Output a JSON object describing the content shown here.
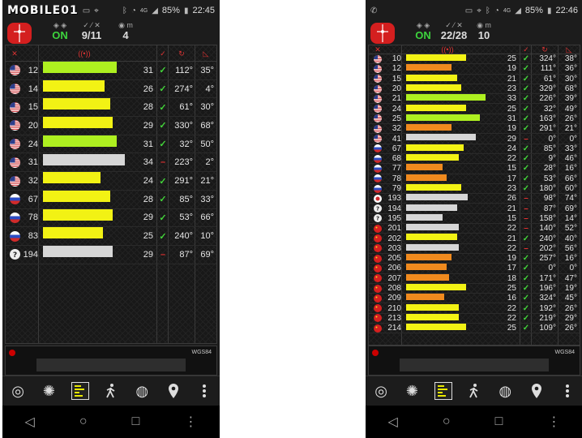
{
  "left": {
    "status": {
      "brand": "MOBILE01",
      "battery": "85%",
      "time": "22:45",
      "signal": "4G"
    },
    "header": {
      "fix_status": "ON",
      "in_use": "9/11",
      "extra": "4"
    },
    "footer": {
      "datum": "WGS84"
    },
    "sats": [
      {
        "flag": "us",
        "prn": "12",
        "snr": "31",
        "level": 0.86,
        "color": "#aef020",
        "used": "check",
        "az": "112°",
        "el": "35°"
      },
      {
        "flag": "us",
        "prn": "14",
        "snr": "26",
        "level": 0.72,
        "color": "#f2f214",
        "used": "check",
        "az": "274°",
        "el": "4°"
      },
      {
        "flag": "us",
        "prn": "15",
        "snr": "28",
        "level": 0.78,
        "color": "#f2f214",
        "used": "check",
        "az": "61°",
        "el": "30°"
      },
      {
        "flag": "us",
        "prn": "20",
        "snr": "29",
        "level": 0.81,
        "color": "#f2f214",
        "used": "check",
        "az": "330°",
        "el": "68°"
      },
      {
        "flag": "us",
        "prn": "24",
        "snr": "31",
        "level": 0.86,
        "color": "#aef020",
        "used": "check",
        "az": "32°",
        "el": "50°"
      },
      {
        "flag": "us",
        "prn": "31",
        "snr": "34",
        "level": 0.95,
        "color": "#d6d6d6",
        "used": "dash",
        "az": "223°",
        "el": "2°"
      },
      {
        "flag": "us",
        "prn": "32",
        "snr": "24",
        "level": 0.67,
        "color": "#f2f214",
        "used": "check",
        "az": "291°",
        "el": "21°"
      },
      {
        "flag": "ru",
        "prn": "67",
        "snr": "28",
        "level": 0.78,
        "color": "#f2f214",
        "used": "check",
        "az": "85°",
        "el": "33°"
      },
      {
        "flag": "ru",
        "prn": "78",
        "snr": "29",
        "level": 0.81,
        "color": "#f2f214",
        "used": "check",
        "az": "53°",
        "el": "66°"
      },
      {
        "flag": "ru",
        "prn": "83",
        "snr": "25",
        "level": 0.7,
        "color": "#f2f214",
        "used": "check",
        "az": "240°",
        "el": "10°"
      },
      {
        "flag": "q",
        "prn": "194",
        "snr": "29",
        "level": 0.81,
        "color": "#d6d6d6",
        "used": "dash",
        "az": "87°",
        "el": "69°"
      }
    ]
  },
  "right": {
    "status": {
      "battery": "85%",
      "time": "22:46",
      "signal": "4G"
    },
    "header": {
      "fix_status": "ON",
      "in_use": "22/28",
      "extra": "10"
    },
    "footer": {
      "datum": "WGS84"
    },
    "sats": [
      {
        "flag": "us",
        "prn": "10",
        "snr": "25",
        "level": 0.7,
        "color": "#f2f214",
        "used": "check",
        "az": "324°",
        "el": "38°"
      },
      {
        "flag": "us",
        "prn": "12",
        "snr": "19",
        "level": 0.53,
        "color": "#f08a1e",
        "used": "check",
        "az": "111°",
        "el": "36°"
      },
      {
        "flag": "us",
        "prn": "15",
        "snr": "21",
        "level": 0.59,
        "color": "#f2f214",
        "used": "check",
        "az": "61°",
        "el": "30°"
      },
      {
        "flag": "us",
        "prn": "20",
        "snr": "23",
        "level": 0.64,
        "color": "#f2f214",
        "used": "check",
        "az": "329°",
        "el": "68°"
      },
      {
        "flag": "us",
        "prn": "21",
        "snr": "33",
        "level": 0.92,
        "color": "#aef020",
        "used": "check",
        "az": "226°",
        "el": "39°"
      },
      {
        "flag": "us",
        "prn": "24",
        "snr": "25",
        "level": 0.7,
        "color": "#f2f214",
        "used": "check",
        "az": "32°",
        "el": "49°"
      },
      {
        "flag": "us",
        "prn": "25",
        "snr": "31",
        "level": 0.86,
        "color": "#aef020",
        "used": "check",
        "az": "163°",
        "el": "26°"
      },
      {
        "flag": "us",
        "prn": "32",
        "snr": "19",
        "level": 0.53,
        "color": "#f08a1e",
        "used": "check",
        "az": "291°",
        "el": "21°"
      },
      {
        "flag": "us",
        "prn": "41",
        "snr": "29",
        "level": 0.81,
        "color": "#d6d6d6",
        "used": "dash",
        "az": "0°",
        "el": "0°"
      },
      {
        "flag": "ru",
        "prn": "67",
        "snr": "24",
        "level": 0.67,
        "color": "#f2f214",
        "used": "check",
        "az": "85°",
        "el": "33°"
      },
      {
        "flag": "ru",
        "prn": "68",
        "snr": "22",
        "level": 0.61,
        "color": "#f2f214",
        "used": "check",
        "az": "9°",
        "el": "46°"
      },
      {
        "flag": "ru",
        "prn": "77",
        "snr": "15",
        "level": 0.42,
        "color": "#f08a1e",
        "used": "check",
        "az": "28°",
        "el": "16°"
      },
      {
        "flag": "ru",
        "prn": "78",
        "snr": "17",
        "level": 0.47,
        "color": "#f08a1e",
        "used": "check",
        "az": "53°",
        "el": "66°"
      },
      {
        "flag": "ru",
        "prn": "79",
        "snr": "23",
        "level": 0.64,
        "color": "#f2f214",
        "used": "check",
        "az": "180°",
        "el": "60°"
      },
      {
        "flag": "jp",
        "prn": "193",
        "snr": "26",
        "level": 0.72,
        "color": "#d6d6d6",
        "used": "dash",
        "az": "98°",
        "el": "74°"
      },
      {
        "flag": "q",
        "prn": "194",
        "snr": "21",
        "level": 0.59,
        "color": "#d6d6d6",
        "used": "dash",
        "az": "87°",
        "el": "69°"
      },
      {
        "flag": "q",
        "prn": "195",
        "snr": "15",
        "level": 0.42,
        "color": "#d6d6d6",
        "used": "dash",
        "az": "158°",
        "el": "14°"
      },
      {
        "flag": "cn",
        "prn": "201",
        "snr": "22",
        "level": 0.61,
        "color": "#d6d6d6",
        "used": "dash",
        "az": "140°",
        "el": "52°"
      },
      {
        "flag": "cn",
        "prn": "202",
        "snr": "21",
        "level": 0.59,
        "color": "#f2f214",
        "used": "check",
        "az": "240°",
        "el": "40°"
      },
      {
        "flag": "cn",
        "prn": "203",
        "snr": "22",
        "level": 0.61,
        "color": "#d6d6d6",
        "used": "dash",
        "az": "202°",
        "el": "56°"
      },
      {
        "flag": "cn",
        "prn": "205",
        "snr": "19",
        "level": 0.53,
        "color": "#f08a1e",
        "used": "check",
        "az": "257°",
        "el": "16°"
      },
      {
        "flag": "cn",
        "prn": "206",
        "snr": "17",
        "level": 0.47,
        "color": "#f08a1e",
        "used": "check",
        "az": "0°",
        "el": "0°"
      },
      {
        "flag": "cn",
        "prn": "207",
        "snr": "18",
        "level": 0.5,
        "color": "#f08a1e",
        "used": "check",
        "az": "171°",
        "el": "47°"
      },
      {
        "flag": "cn",
        "prn": "208",
        "snr": "25",
        "level": 0.7,
        "color": "#f2f214",
        "used": "check",
        "az": "196°",
        "el": "19°"
      },
      {
        "flag": "cn",
        "prn": "209",
        "snr": "16",
        "level": 0.44,
        "color": "#f08a1e",
        "used": "check",
        "az": "324°",
        "el": "45°"
      },
      {
        "flag": "cn",
        "prn": "210",
        "snr": "22",
        "level": 0.61,
        "color": "#f2f214",
        "used": "check",
        "az": "192°",
        "el": "26°"
      },
      {
        "flag": "cn",
        "prn": "213",
        "snr": "22",
        "level": 0.61,
        "color": "#f2f214",
        "used": "check",
        "az": "219°",
        "el": "29°"
      },
      {
        "flag": "cn",
        "prn": "214",
        "snr": "25",
        "level": 0.7,
        "color": "#f2f214",
        "used": "check",
        "az": "109°",
        "el": "26°"
      }
    ]
  },
  "colors": {
    "used": "#43d43a",
    "unused": "#e03030",
    "header_icon": "#d33",
    "on": "#3dd33d"
  },
  "toolbar": [
    "compass-icon",
    "radar-icon",
    "signal-bars-icon",
    "walker-icon",
    "globe-icon",
    "map-pin-icon",
    "overflow-menu-icon"
  ],
  "navbar": [
    "back-icon",
    "home-icon",
    "recents-icon",
    "more-icon"
  ]
}
